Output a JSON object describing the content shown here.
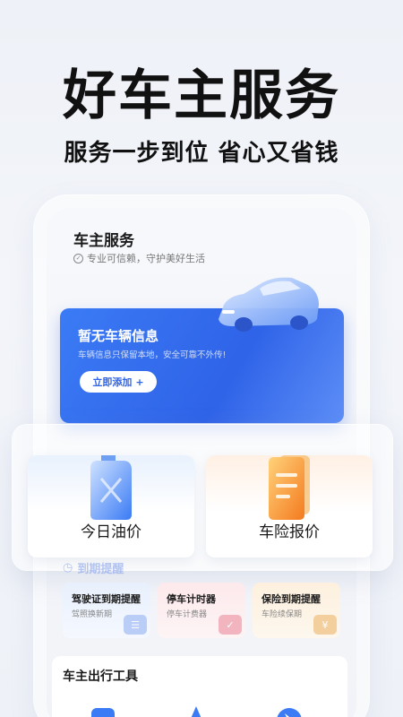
{
  "headline": "好车主服务",
  "subline": "服务一步到位 省心又省钱",
  "service": {
    "title": "车主服务",
    "subtitle": "专业可信赖，守护美好生活"
  },
  "car_card": {
    "title": "暂无车辆信息",
    "desc": "车辆信息只保留本地，安全可靠不外传!",
    "add_label": "立即添加",
    "add_icon": "plus-icon"
  },
  "tiles": [
    {
      "label": "今日油价",
      "icon": "fuel-can-icon"
    },
    {
      "label": "车险报价",
      "icon": "insurance-doc-icon"
    }
  ],
  "reminder": {
    "header": "到期提醒",
    "cards": [
      {
        "title": "驾驶证到期提醒",
        "sub": "驾照换新期"
      },
      {
        "title": "停车计时器",
        "sub": "停车计费器"
      },
      {
        "title": "保险到期提醒",
        "sub": "车险续保期",
        "deco": "¥"
      }
    ]
  },
  "tools": {
    "title": "车主出行工具"
  },
  "colors": {
    "accent_blue": "#2f63e8",
    "oil_tint": "#e8f1fd",
    "insurance_tint": "#fff0e4"
  }
}
